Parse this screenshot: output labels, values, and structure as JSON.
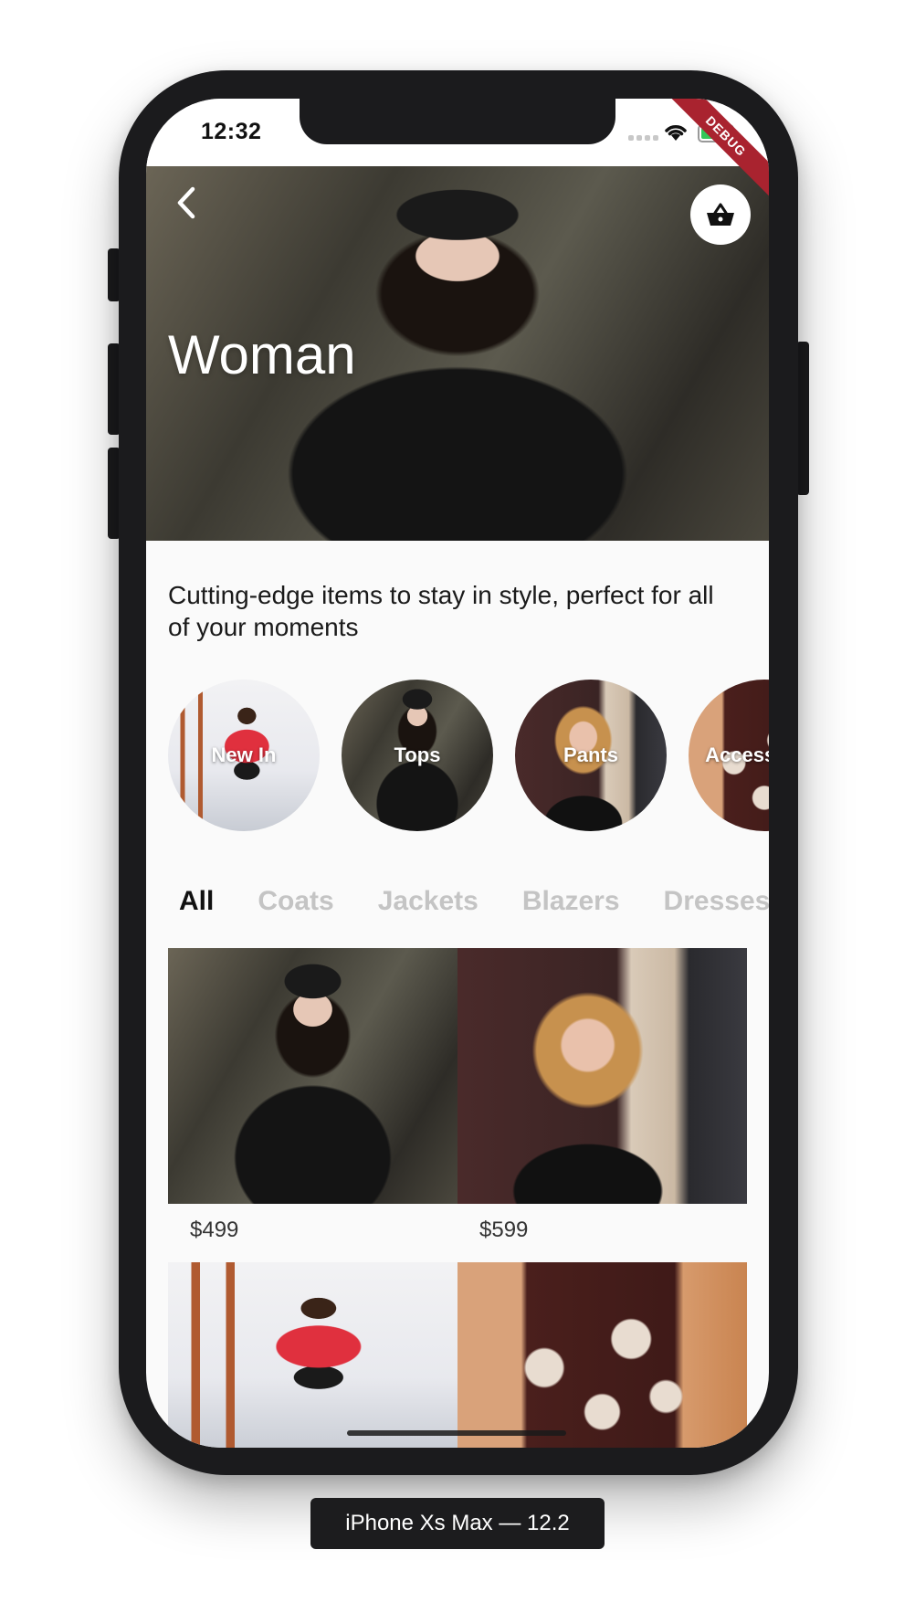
{
  "status_bar": {
    "time": "12:32",
    "debug_label": "DEBUG"
  },
  "hero": {
    "title": "Woman",
    "back_icon": "chevron-left-icon",
    "cart_icon": "basket-icon"
  },
  "description": "Cutting-edge items to stay in style, perfect for all of your moments",
  "categories": [
    {
      "label": "New In"
    },
    {
      "label": "Tops"
    },
    {
      "label": "Pants"
    },
    {
      "label": "Accessories"
    }
  ],
  "tabs": [
    {
      "label": "All",
      "active": true
    },
    {
      "label": "Coats"
    },
    {
      "label": "Jackets"
    },
    {
      "label": "Blazers"
    },
    {
      "label": "Dresses"
    }
  ],
  "products": [
    {
      "price": "$499"
    },
    {
      "price": "$599"
    },
    {
      "price": ""
    },
    {
      "price": ""
    }
  ],
  "device_caption": "iPhone Xs Max — 12.2",
  "colors": {
    "accent_dark": "#111111",
    "tab_inactive": "#c4c4c4",
    "debug_ribbon": "#a9232f"
  }
}
